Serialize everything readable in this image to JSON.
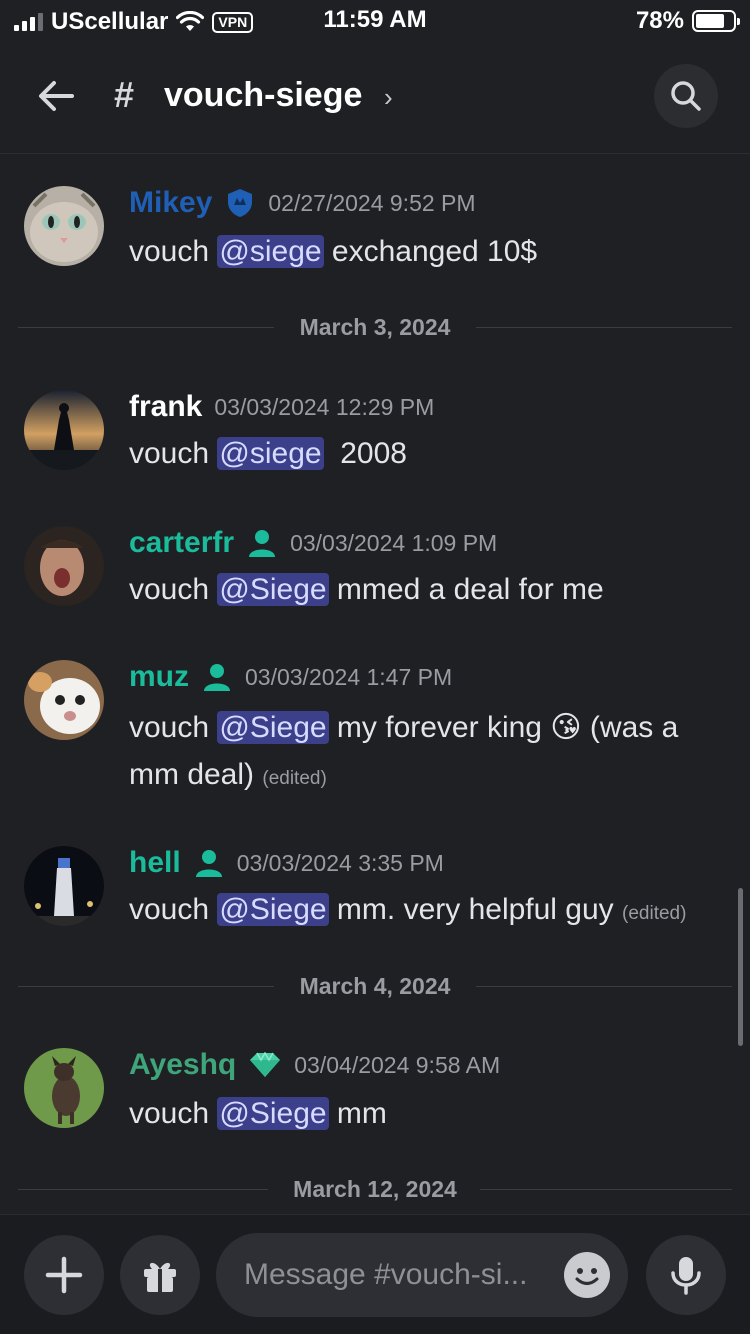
{
  "status_bar": {
    "carrier": "UScellular",
    "vpn": "VPN",
    "time": "11:59 AM",
    "battery": "78%",
    "battery_level": 0.78
  },
  "header": {
    "hash": "#",
    "channel": "vouch-siege",
    "chevron": "›"
  },
  "messages": [
    {
      "author": "Mikey",
      "author_color": "#1f5fb5",
      "badge": "shield-icon",
      "timestamp": "02/27/2024 9:52 PM",
      "pre": "vouch ",
      "mention": "@siege",
      "post": " exchanged 10$",
      "edited": ""
    },
    {
      "author": "frank",
      "author_color": "#ffffff",
      "badge": "",
      "timestamp": "03/03/2024 12:29 PM",
      "pre": "vouch ",
      "mention": "@siege",
      "post": "  2008",
      "edited": ""
    },
    {
      "author": "carterfr",
      "author_color": "#1abc9c",
      "badge": "person-icon",
      "timestamp": "03/03/2024 1:09 PM",
      "pre": "vouch ",
      "mention": "@Siege",
      "post": " mmed a deal for me",
      "edited": ""
    },
    {
      "author": "muz",
      "author_color": "#1abc9c",
      "badge": "person-icon",
      "timestamp": "03/03/2024 1:47 PM",
      "pre": "vouch ",
      "mention": "@Siege",
      "post": " my forever king 😘 (was a mm deal)",
      "edited": "(edited)"
    },
    {
      "author": "hell",
      "author_color": "#1abc9c",
      "badge": "person-icon",
      "timestamp": "03/03/2024 3:35 PM",
      "pre": "vouch ",
      "mention": "@Siege",
      "post": " mm. very helpful guy",
      "edited": "(edited)"
    },
    {
      "author": "Ayeshq",
      "author_color": "#3fa57a",
      "badge": "gem-icon",
      "timestamp": "03/04/2024 9:58 AM",
      "pre": "vouch ",
      "mention": "@Siege",
      "post": " mm",
      "edited": ""
    }
  ],
  "dividers": [
    "March 3, 2024",
    "March 4, 2024",
    "March 12, 2024"
  ],
  "composer": {
    "placeholder": "Message #vouch-si..."
  },
  "colors": {
    "background": "#1f2024",
    "mention_bg": "#3c3f8a",
    "role_teal": "#1abc9c"
  }
}
